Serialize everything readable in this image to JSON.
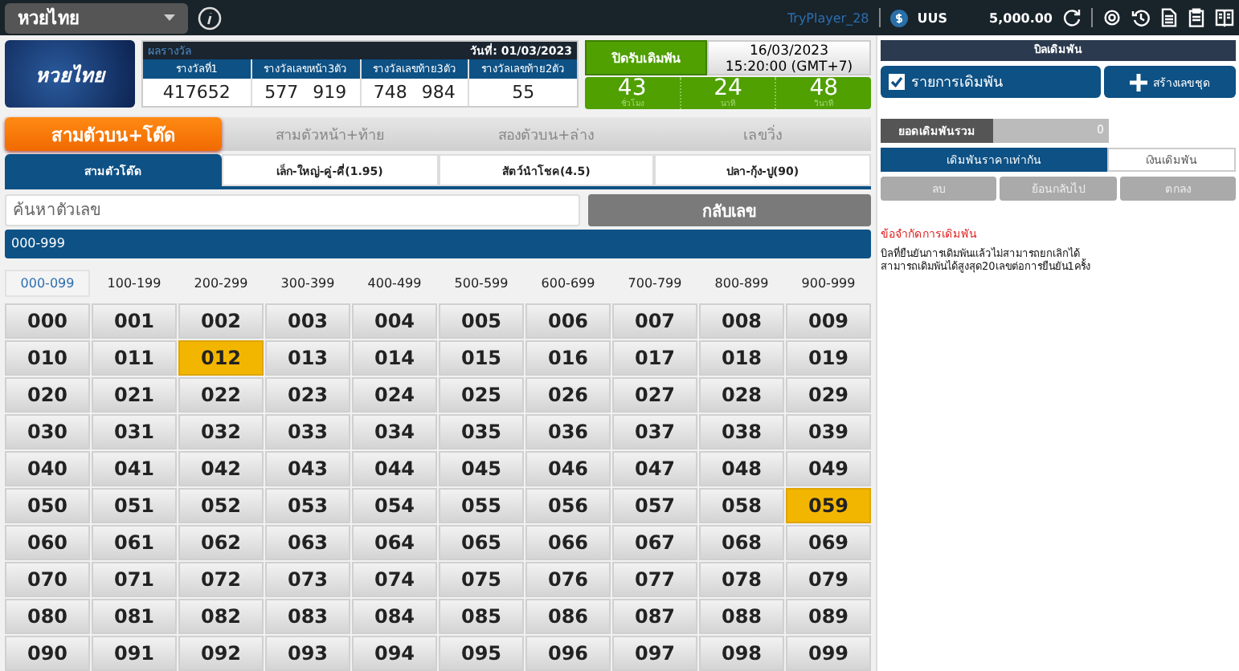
{
  "topbar": {
    "lottery_select": "หวยไทย",
    "user": "TryPlayer_28",
    "currency": "UUS",
    "balance": "5,000.00"
  },
  "logo": {
    "text": "หวยไทย"
  },
  "results": {
    "title": "ผลรางวัล",
    "date": "วันที่: 01/03/2023",
    "columns": [
      {
        "label": "รางวัลที่1",
        "values": [
          "417652"
        ]
      },
      {
        "label": "รางวัลเลขหน้า3ตัว",
        "values": [
          "577",
          "919"
        ]
      },
      {
        "label": "รางวัลเลขท้าย3ตัว",
        "values": [
          "748",
          "984"
        ]
      },
      {
        "label": "รางวัลเลขท้าย2ตัว",
        "values": [
          "55"
        ]
      }
    ]
  },
  "closing": {
    "label": "ปิดรับเดิมพัน",
    "date": "16/03/2023",
    "time": "15:20:00 (GMT+7)",
    "countdown": [
      {
        "value": "43",
        "unit": "ชั่วโมง"
      },
      {
        "value": "24",
        "unit": "นาที"
      },
      {
        "value": "48",
        "unit": "วินาที"
      }
    ]
  },
  "tabs": [
    {
      "label": "สามตัวบน+โต๊ด",
      "selected": true
    },
    {
      "label": "สามตัวหน้า+ท้าย",
      "selected": false
    },
    {
      "label": "สองตัวบน+ล่าง",
      "selected": false
    },
    {
      "label": "เลขวิ่ง",
      "selected": false
    }
  ],
  "subtabs": [
    {
      "label": "สามตัวโต๊ด",
      "selected": true
    },
    {
      "label": "เล็ก-ใหญ่-คู่-คี่(1.95)",
      "selected": false
    },
    {
      "label": "สัตว์นำโชค(4.5)",
      "selected": false
    },
    {
      "label": "ปลา-กุ้ง-ปู(90)",
      "selected": false
    }
  ],
  "search": {
    "placeholder": "ค้นหาตัวเลข",
    "button": "กลับเลข"
  },
  "range_bar": "000-999",
  "ranges": [
    {
      "label": "000-099",
      "selected": true
    },
    {
      "label": "100-199",
      "selected": false
    },
    {
      "label": "200-299",
      "selected": false
    },
    {
      "label": "300-399",
      "selected": false
    },
    {
      "label": "400-499",
      "selected": false
    },
    {
      "label": "500-599",
      "selected": false
    },
    {
      "label": "600-699",
      "selected": false
    },
    {
      "label": "700-799",
      "selected": false
    },
    {
      "label": "800-899",
      "selected": false
    },
    {
      "label": "900-999",
      "selected": false
    }
  ],
  "numbers": [
    {
      "label": "000",
      "selected": false
    },
    {
      "label": "001",
      "selected": false
    },
    {
      "label": "002",
      "selected": false
    },
    {
      "label": "003",
      "selected": false
    },
    {
      "label": "004",
      "selected": false
    },
    {
      "label": "005",
      "selected": false
    },
    {
      "label": "006",
      "selected": false
    },
    {
      "label": "007",
      "selected": false
    },
    {
      "label": "008",
      "selected": false
    },
    {
      "label": "009",
      "selected": false
    },
    {
      "label": "010",
      "selected": false
    },
    {
      "label": "011",
      "selected": false
    },
    {
      "label": "012",
      "selected": true
    },
    {
      "label": "013",
      "selected": false
    },
    {
      "label": "014",
      "selected": false
    },
    {
      "label": "015",
      "selected": false
    },
    {
      "label": "016",
      "selected": false
    },
    {
      "label": "017",
      "selected": false
    },
    {
      "label": "018",
      "selected": false
    },
    {
      "label": "019",
      "selected": false
    },
    {
      "label": "020",
      "selected": false
    },
    {
      "label": "021",
      "selected": false
    },
    {
      "label": "022",
      "selected": false
    },
    {
      "label": "023",
      "selected": false
    },
    {
      "label": "024",
      "selected": false
    },
    {
      "label": "025",
      "selected": false
    },
    {
      "label": "026",
      "selected": false
    },
    {
      "label": "027",
      "selected": false
    },
    {
      "label": "028",
      "selected": false
    },
    {
      "label": "029",
      "selected": false
    },
    {
      "label": "030",
      "selected": false
    },
    {
      "label": "031",
      "selected": false
    },
    {
      "label": "032",
      "selected": false
    },
    {
      "label": "033",
      "selected": false
    },
    {
      "label": "034",
      "selected": false
    },
    {
      "label": "035",
      "selected": false
    },
    {
      "label": "036",
      "selected": false
    },
    {
      "label": "037",
      "selected": false
    },
    {
      "label": "038",
      "selected": false
    },
    {
      "label": "039",
      "selected": false
    },
    {
      "label": "040",
      "selected": false
    },
    {
      "label": "041",
      "selected": false
    },
    {
      "label": "042",
      "selected": false
    },
    {
      "label": "043",
      "selected": false
    },
    {
      "label": "044",
      "selected": false
    },
    {
      "label": "045",
      "selected": false
    },
    {
      "label": "046",
      "selected": false
    },
    {
      "label": "047",
      "selected": false
    },
    {
      "label": "048",
      "selected": false
    },
    {
      "label": "049",
      "selected": false
    },
    {
      "label": "050",
      "selected": false
    },
    {
      "label": "051",
      "selected": false
    },
    {
      "label": "052",
      "selected": false
    },
    {
      "label": "053",
      "selected": false
    },
    {
      "label": "054",
      "selected": false
    },
    {
      "label": "055",
      "selected": false
    },
    {
      "label": "056",
      "selected": false
    },
    {
      "label": "057",
      "selected": false
    },
    {
      "label": "058",
      "selected": false
    },
    {
      "label": "059",
      "selected": true
    },
    {
      "label": "060",
      "selected": false
    },
    {
      "label": "061",
      "selected": false
    },
    {
      "label": "062",
      "selected": false
    },
    {
      "label": "063",
      "selected": false
    },
    {
      "label": "064",
      "selected": false
    },
    {
      "label": "065",
      "selected": false
    },
    {
      "label": "066",
      "selected": false
    },
    {
      "label": "067",
      "selected": false
    },
    {
      "label": "068",
      "selected": false
    },
    {
      "label": "069",
      "selected": false
    },
    {
      "label": "070",
      "selected": false
    },
    {
      "label": "071",
      "selected": false
    },
    {
      "label": "072",
      "selected": false
    },
    {
      "label": "073",
      "selected": false
    },
    {
      "label": "074",
      "selected": false
    },
    {
      "label": "075",
      "selected": false
    },
    {
      "label": "076",
      "selected": false
    },
    {
      "label": "077",
      "selected": false
    },
    {
      "label": "078",
      "selected": false
    },
    {
      "label": "079",
      "selected": false
    },
    {
      "label": "080",
      "selected": false
    },
    {
      "label": "081",
      "selected": false
    },
    {
      "label": "082",
      "selected": false
    },
    {
      "label": "083",
      "selected": false
    },
    {
      "label": "084",
      "selected": false
    },
    {
      "label": "085",
      "selected": false
    },
    {
      "label": "086",
      "selected": false
    },
    {
      "label": "087",
      "selected": false
    },
    {
      "label": "088",
      "selected": false
    },
    {
      "label": "089",
      "selected": false
    },
    {
      "label": "090",
      "selected": false
    },
    {
      "label": "091",
      "selected": false
    },
    {
      "label": "092",
      "selected": false
    },
    {
      "label": "093",
      "selected": false
    },
    {
      "label": "094",
      "selected": false
    },
    {
      "label": "095",
      "selected": false
    },
    {
      "label": "096",
      "selected": false
    },
    {
      "label": "097",
      "selected": false
    },
    {
      "label": "098",
      "selected": false
    },
    {
      "label": "099",
      "selected": false
    }
  ],
  "bet_slip": {
    "title": "บิลเดิมพัน",
    "list_button": "รายการเดิมพัน",
    "list_checked": true,
    "create_button": "สร้างเลขชุด",
    "total_label": "ยอดเดิมพันรวม",
    "total_value": "0",
    "modes": [
      {
        "label": "เดิมพันราคาเท่ากัน",
        "selected": true
      },
      {
        "label": "เงินเดิมพัน",
        "selected": false
      }
    ],
    "actions": [
      "ลบ",
      "ย้อนกลับไป",
      "ตกลง"
    ],
    "notice_title": "ข้อจำกัดการเดิมพัน",
    "notice_lines": [
      "บิลที่ยืนยันการเดิมพันแล้วไม่สามารถยกเลิกได้",
      "สามารถเดิมพันได้สูงสุด20เลขต่อการยืนยัน1ครั้ง"
    ]
  }
}
